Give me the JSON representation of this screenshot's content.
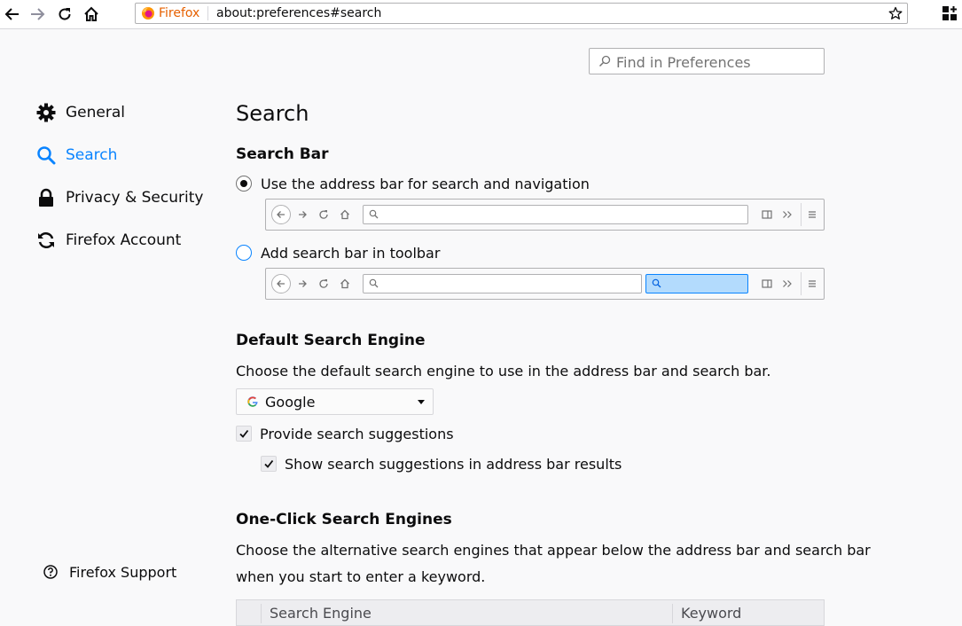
{
  "browser": {
    "identity_label": "Firefox",
    "url": "about:preferences#search"
  },
  "find": {
    "placeholder": "Find in Preferences"
  },
  "sidebar": {
    "items": [
      {
        "label": "General",
        "icon": "gear-icon"
      },
      {
        "label": "Search",
        "icon": "search-icon",
        "selected": true
      },
      {
        "label": "Privacy & Security",
        "icon": "lock-icon"
      },
      {
        "label": "Firefox Account",
        "icon": "sync-icon"
      }
    ],
    "support_label": "Firefox Support"
  },
  "main": {
    "title": "Search",
    "search_bar": {
      "heading": "Search Bar",
      "option_address": "Use the address bar for search and navigation",
      "option_toolbar": "Add search bar in toolbar",
      "selected": "address"
    },
    "default_engine": {
      "heading": "Default Search Engine",
      "description": "Choose the default search engine to use in the address bar and search bar.",
      "selected_engine": "Google",
      "provide_suggestions": "Provide search suggestions",
      "provide_suggestions_checked": true,
      "show_in_address_bar": "Show search suggestions in address bar results",
      "show_in_address_bar_checked": true
    },
    "one_click": {
      "heading": "One-Click Search Engines",
      "description_line1": "Choose the alternative search engines that appear below the address bar and search bar",
      "description_line2": "when you start to enter a keyword.",
      "columns": [
        "Search Engine",
        "Keyword"
      ]
    }
  },
  "colors": {
    "accent": "#0a84ff",
    "background": "#f9f9fa",
    "text": "#0c0c0d"
  }
}
